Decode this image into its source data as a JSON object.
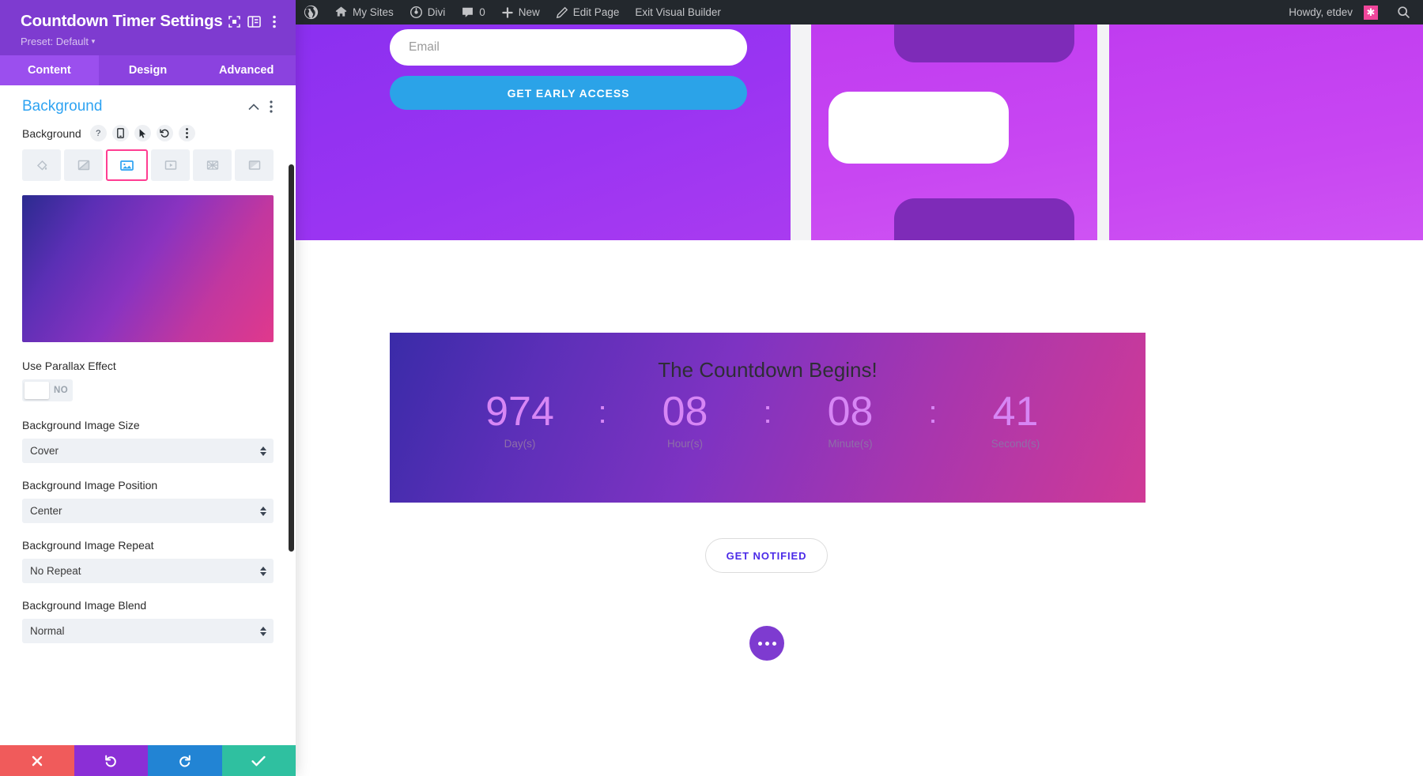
{
  "settings_panel": {
    "title": "Countdown Timer Settings",
    "preset_label": "Preset: Default",
    "header_icons": [
      {
        "name": "focus-icon"
      },
      {
        "name": "layout-toggle-icon"
      },
      {
        "name": "more-options-icon"
      }
    ],
    "tabs": [
      {
        "label": "Content",
        "active": true
      },
      {
        "label": "Design",
        "active": false
      },
      {
        "label": "Advanced",
        "active": false
      }
    ],
    "section": {
      "title": "Background",
      "collapse_icon": "chevron-up-icon",
      "more_icon": "more-options-icon"
    },
    "background_field": {
      "label": "Background",
      "mini_buttons": [
        {
          "name": "help-icon",
          "glyph": "?"
        },
        {
          "name": "responsive-icon",
          "glyph": "▭"
        },
        {
          "name": "hover-icon",
          "glyph": "➤"
        },
        {
          "name": "reset-icon",
          "glyph": "↺"
        },
        {
          "name": "more-options-icon",
          "glyph": "⋮"
        }
      ],
      "types": [
        {
          "name": "background-color-icon",
          "selected": false
        },
        {
          "name": "background-gradient-icon",
          "selected": false
        },
        {
          "name": "background-image-icon",
          "selected": true
        },
        {
          "name": "background-video-icon",
          "selected": false
        },
        {
          "name": "background-pattern-icon",
          "selected": false
        },
        {
          "name": "background-mask-icon",
          "selected": false
        }
      ]
    },
    "fields": [
      {
        "label": "Use Parallax Effect",
        "type": "toggle",
        "value": "NO"
      },
      {
        "label": "Background Image Size",
        "type": "select",
        "value": "Cover"
      },
      {
        "label": "Background Image Position",
        "type": "select",
        "value": "Center"
      },
      {
        "label": "Background Image Repeat",
        "type": "select",
        "value": "No Repeat"
      },
      {
        "label": "Background Image Blend",
        "type": "select",
        "value": "Normal"
      }
    ],
    "actions": [
      {
        "name": "discard-button",
        "icon": "close-icon",
        "color": "#F05B5B"
      },
      {
        "name": "undo-button",
        "icon": "undo-icon",
        "color": "#8B2FD6"
      },
      {
        "name": "redo-button",
        "icon": "redo-icon",
        "color": "#2284D4"
      },
      {
        "name": "save-button",
        "icon": "check-icon",
        "color": "#2FC0A0"
      }
    ]
  },
  "admin_bar": {
    "items": [
      {
        "name": "wordpress-logo-icon",
        "label": ""
      },
      {
        "name": "my-sites-menu",
        "label": "My Sites"
      },
      {
        "name": "divi-menu",
        "label": "Divi"
      },
      {
        "name": "comments-menu",
        "label": "0"
      },
      {
        "name": "new-content-menu",
        "label": "New"
      },
      {
        "name": "edit-page-link",
        "label": "Edit Page"
      },
      {
        "name": "exit-visual-builder-link",
        "label": "Exit Visual Builder"
      }
    ],
    "greeting": "Howdy, etdev",
    "search_icon": "search-icon"
  },
  "page": {
    "email_placeholder": "Email",
    "cta_label": "GET EARLY ACCESS",
    "countdown": {
      "title": "The Countdown Begins!",
      "separator": ":",
      "units": [
        {
          "value": "974",
          "label": "Day(s)"
        },
        {
          "value": "08",
          "label": "Hour(s)"
        },
        {
          "value": "08",
          "label": "Minute(s)"
        },
        {
          "value": "41",
          "label": "Second(s)"
        }
      ]
    },
    "notify_label": "GET NOTIFIED",
    "fab_icon": "more-options-icon"
  },
  "colors": {
    "panel_purple": "#7E3BD0",
    "tab_active": "#9B4FEE",
    "section_blue": "#2EA3F2",
    "selected_outline": "#FF3D92",
    "cta_blue": "#2BA3E8",
    "notify_indigo": "#4B2BE8",
    "countdown_number": "#D786F5",
    "admin_bar": "#23282D",
    "avatar_pink": "#F0469B"
  }
}
